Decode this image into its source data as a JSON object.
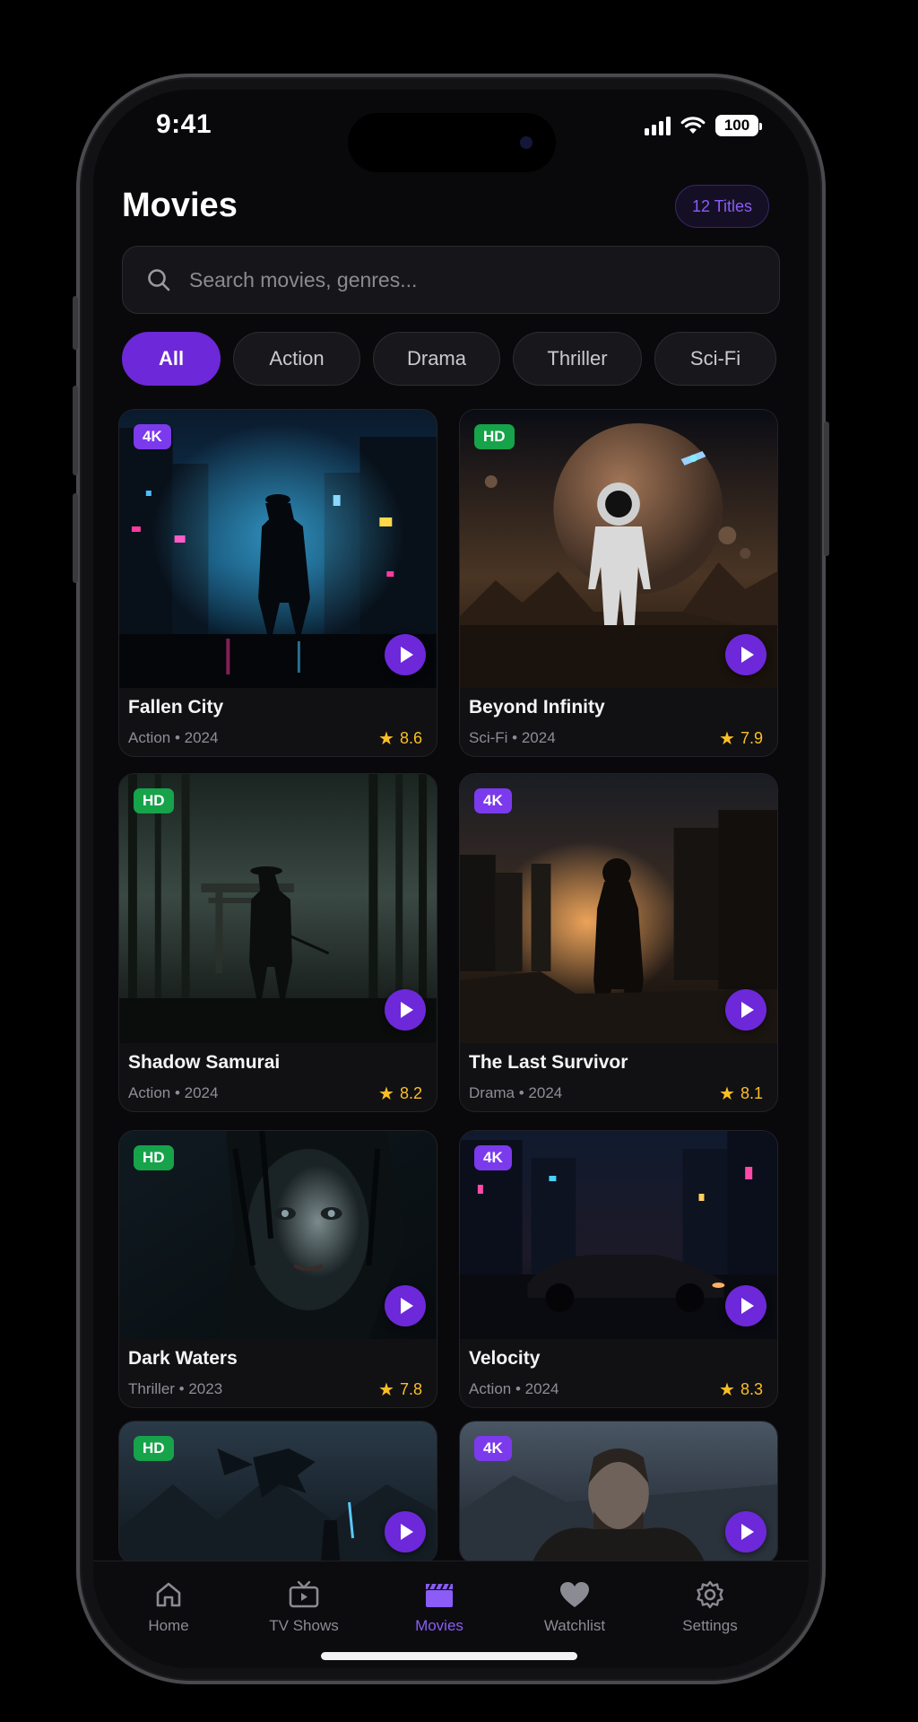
{
  "status_bar": {
    "time": "9:41",
    "battery": "100"
  },
  "header": {
    "title": "Movies",
    "count_badge": "12 Titles"
  },
  "search": {
    "placeholder": "Search movies, genres..."
  },
  "filters": [
    "All",
    "Action",
    "Drama",
    "Thriller",
    "Sci-Fi"
  ],
  "active_filter": "All",
  "movies": [
    {
      "title": "Fallen City",
      "meta": "Action • 2024",
      "rating": "8.6",
      "quality": "4K"
    },
    {
      "title": "Beyond Infinity",
      "meta": "Sci-Fi • 2024",
      "rating": "7.9",
      "quality": "HD"
    },
    {
      "title": "Shadow Samurai",
      "meta": "Action • 2024",
      "rating": "8.2",
      "quality": "HD"
    },
    {
      "title": "The Last Survivor",
      "meta": "Drama • 2024",
      "rating": "8.1",
      "quality": "4K"
    },
    {
      "title": "Dark Waters",
      "meta": "Thriller • 2023",
      "rating": "7.8",
      "quality": "HD"
    },
    {
      "title": "Velocity",
      "meta": "Action • 2024",
      "rating": "8.3",
      "quality": "4K"
    },
    {
      "quality": "HD"
    },
    {
      "quality": "4K"
    }
  ],
  "tab_bar": [
    {
      "label": "Home",
      "icon": "home-icon"
    },
    {
      "label": "TV Shows",
      "icon": "tv-icon"
    },
    {
      "label": "Movies",
      "icon": "clapperboard-icon",
      "active": true
    },
    {
      "label": "Watchlist",
      "icon": "heart-icon"
    },
    {
      "label": "Settings",
      "icon": "gear-icon"
    }
  ],
  "colors": {
    "accent": "#6d28d9",
    "accent_text": "#8b5cf6",
    "quality_4k": "#7c3aed",
    "quality_hd": "#16a34a",
    "rating": "#fbbf24",
    "background": "#09090b"
  }
}
